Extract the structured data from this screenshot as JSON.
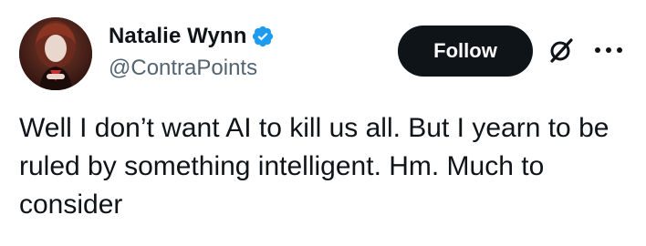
{
  "author": {
    "display_name": "Natalie Wynn",
    "handle": "@ContraPoints",
    "verified": true,
    "verified_color": "#1d9bf0"
  },
  "actions": {
    "follow_label": "Follow",
    "grok_icon": "grok-icon",
    "more_icon": "more-icon"
  },
  "tweet": {
    "text": "Well I don’t want AI to kill us all. But I yearn to be ruled by something intelligent. Hm. Much to consider"
  },
  "colors": {
    "text_primary": "#0f1419",
    "text_secondary": "#536471",
    "button_bg": "#0f1419",
    "button_text": "#ffffff"
  }
}
